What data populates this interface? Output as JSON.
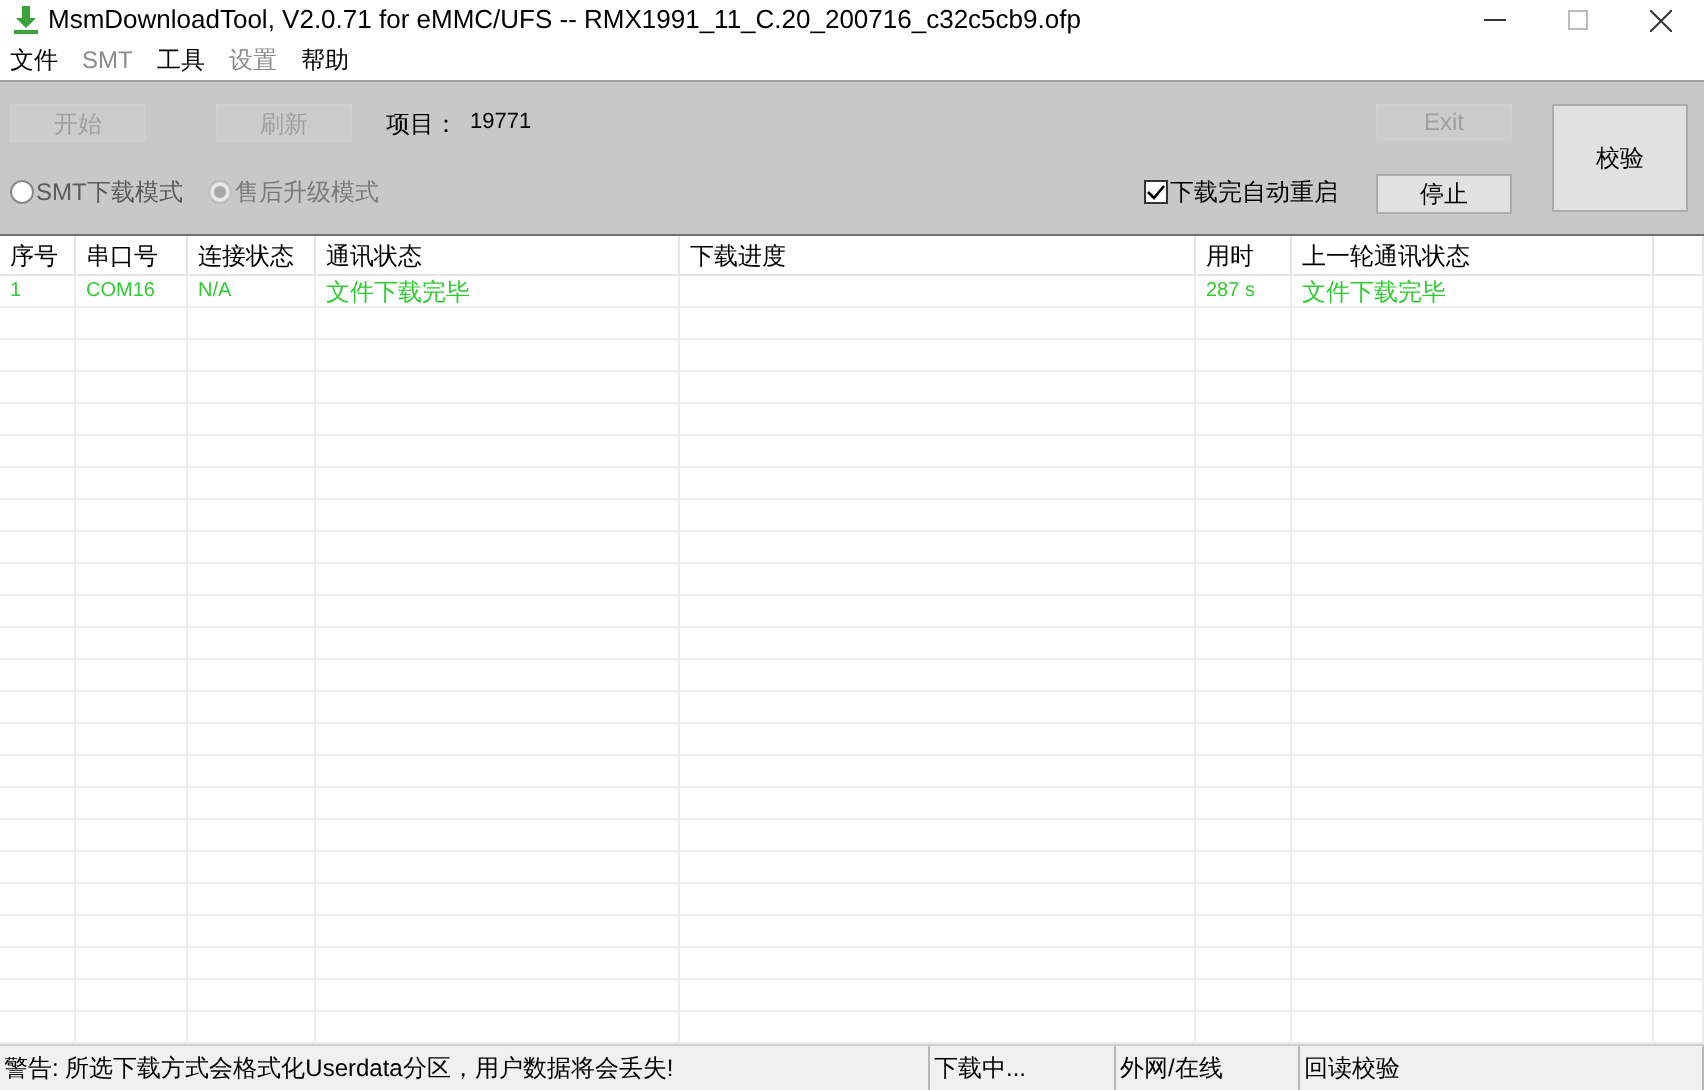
{
  "window": {
    "title": "MsmDownloadTool, V2.0.71 for eMMC/UFS -- RMX1991_11_C.20_200716_c32c5cb9.ofp"
  },
  "menu": [
    {
      "label": "文件",
      "disabled": false
    },
    {
      "label": "SMT",
      "disabled": true
    },
    {
      "label": "工具",
      "disabled": false
    },
    {
      "label": "设置",
      "disabled": true
    },
    {
      "label": "帮助",
      "disabled": false
    }
  ],
  "toolbar": {
    "start_button": {
      "label": "开始",
      "disabled": true
    },
    "refresh_button": {
      "label": "刷新",
      "disabled": true
    },
    "project_label": "项目：",
    "project_value": "19771",
    "modes": [
      {
        "label": "SMT下载模式",
        "selected": false,
        "disabled": false
      },
      {
        "label": "售后升级模式",
        "selected": true,
        "disabled": true
      }
    ],
    "auto_restart": {
      "label": "下载完自动重启",
      "checked": true
    },
    "exit_button": {
      "label": "Exit",
      "disabled": true
    },
    "stop_button": {
      "label": "停止",
      "disabled": false
    },
    "verify_button": {
      "label": "校验",
      "disabled": false
    }
  },
  "table": {
    "columns": [
      "序号",
      "串口号",
      "连接状态",
      "通讯状态",
      "下载进度",
      "用时",
      "上一轮通讯状态"
    ],
    "rows": [
      {
        "index": "1",
        "port": "COM16",
        "connection": "N/A",
        "comm_status": "文件下载完毕",
        "time": "287 s",
        "last_status": "文件下载完毕"
      }
    ]
  },
  "status_bar": [
    "警告: 所选下载方式会格式化Userdata分区，用户数据将会丢失!",
    "下载中...",
    "外网/在线",
    "回读校验"
  ]
}
